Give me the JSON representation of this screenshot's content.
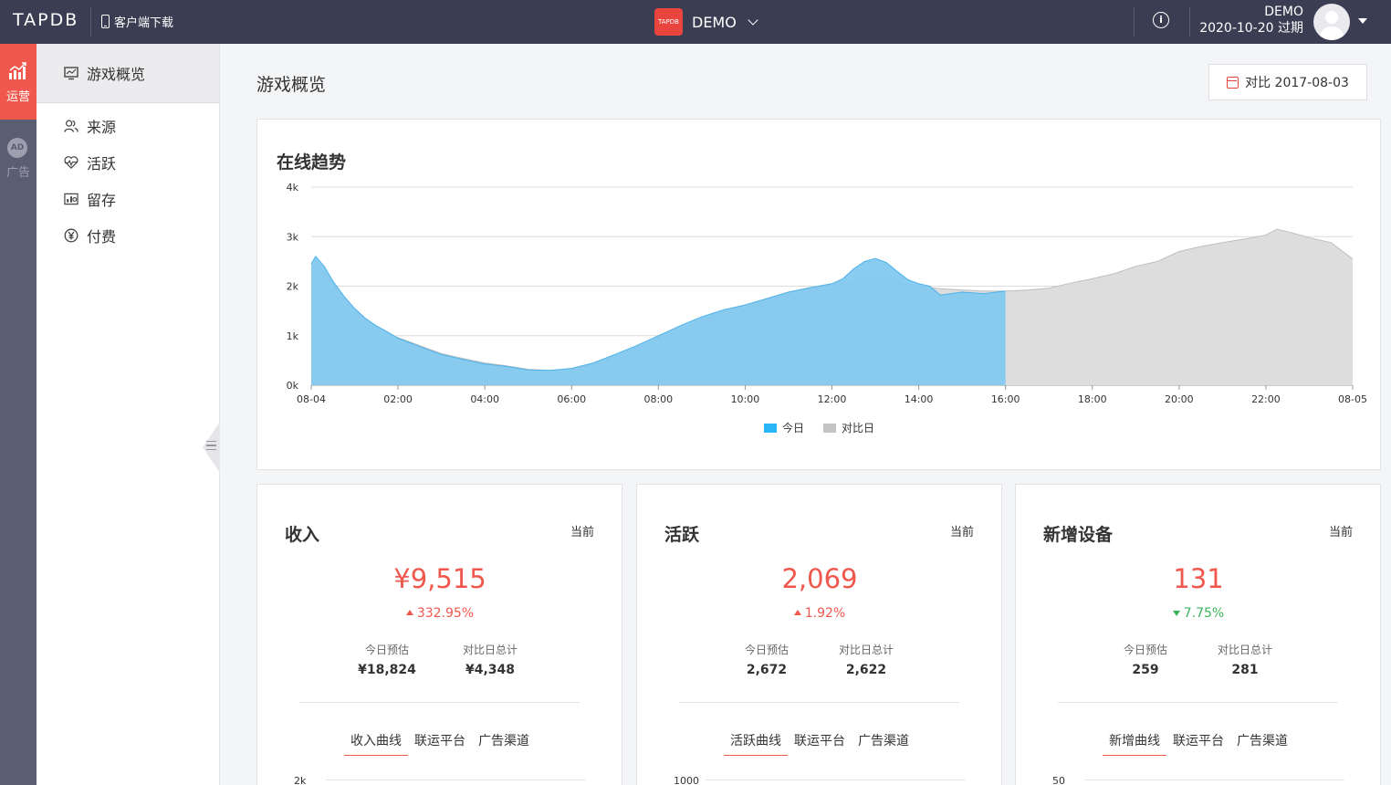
{
  "topbar": {
    "logo": "TAPDB",
    "download": "客户端下载",
    "app_logo_text": "TAPDB",
    "app_name": "DEMO",
    "user_name": "DEMO",
    "user_expiry": "2020-10-20 过期",
    "icons": {
      "download": "phone-icon",
      "info": "info-icon",
      "menu": "chevron-down-icon"
    }
  },
  "rail": {
    "items": [
      {
        "label": "运营",
        "icon": "bar-chart-icon",
        "active": true
      },
      {
        "label": "广告",
        "icon": "ad-icon",
        "icon_text": "AD",
        "active": false
      }
    ]
  },
  "sidebar": {
    "header": {
      "label": "游戏概览",
      "icon": "monitor-icon"
    },
    "items": [
      {
        "label": "来源",
        "icon": "users-icon"
      },
      {
        "label": "活跃",
        "icon": "heartbeat-icon"
      },
      {
        "label": "留存",
        "icon": "image-chart-icon"
      },
      {
        "label": "付费",
        "icon": "yen-icon"
      }
    ]
  },
  "main": {
    "title": "游戏概览",
    "compare_button": "对比 2017-08-03"
  },
  "online_trend": {
    "title": "在线趋势",
    "legend": [
      {
        "name": "今日",
        "color": "#29b6f6"
      },
      {
        "name": "对比日",
        "color": "#c4c4c4"
      }
    ]
  },
  "chart_data": {
    "type": "area",
    "title": "在线趋势",
    "x_ticks": [
      "08-04",
      "02:00",
      "04:00",
      "06:00",
      "08:00",
      "10:00",
      "12:00",
      "14:00",
      "16:00",
      "18:00",
      "20:00",
      "22:00",
      "08-05"
    ],
    "y_ticks": [
      "0k",
      "1k",
      "2k",
      "3k",
      "4k"
    ],
    "ylim": [
      0,
      4000
    ],
    "x_unit": "hours",
    "xlim": [
      0,
      24
    ],
    "legend_position": "bottom-center",
    "grid": true,
    "series": [
      {
        "name": "今日",
        "color": "#29b6f6",
        "x": [
          0,
          0.1,
          0.3,
          0.5,
          0.75,
          1,
          1.25,
          1.5,
          1.75,
          2,
          2.5,
          3,
          3.5,
          4,
          4.5,
          5,
          5.5,
          6,
          6.5,
          7,
          7.5,
          8,
          8.5,
          9,
          9.5,
          10,
          10.5,
          11,
          11.5,
          12,
          12.25,
          12.5,
          12.75,
          13,
          13.25,
          13.5,
          13.75,
          14,
          14.25,
          14.5,
          14.75,
          15,
          15.5,
          16
        ],
        "y": [
          2450,
          2600,
          2400,
          2100,
          1800,
          1550,
          1350,
          1200,
          1080,
          950,
          780,
          620,
          520,
          430,
          380,
          310,
          300,
          340,
          450,
          620,
          800,
          1000,
          1200,
          1380,
          1520,
          1620,
          1750,
          1880,
          1970,
          2050,
          2150,
          2350,
          2500,
          2560,
          2480,
          2300,
          2130,
          2050,
          2000,
          1820,
          1850,
          1880,
          1850,
          1900
        ]
      },
      {
        "name": "对比日",
        "color": "#c4c4c4",
        "x": [
          0,
          0.1,
          0.3,
          0.5,
          0.75,
          1,
          1.25,
          1.5,
          1.75,
          2,
          2.5,
          3,
          3.5,
          4,
          4.5,
          5,
          5.5,
          6,
          6.5,
          7,
          7.5,
          8,
          8.5,
          9,
          9.5,
          10,
          10.5,
          11,
          11.5,
          12,
          12.5,
          13,
          13.5,
          14,
          14.5,
          15,
          15.5,
          16,
          16.5,
          17,
          17.5,
          18,
          18.5,
          19,
          19.5,
          20,
          20.5,
          21,
          21.5,
          22,
          22.25,
          22.5,
          23,
          23.5,
          24
        ],
        "y": [
          2350,
          2500,
          2300,
          2050,
          1750,
          1500,
          1320,
          1180,
          1060,
          960,
          800,
          640,
          540,
          450,
          390,
          320,
          300,
          330,
          430,
          580,
          760,
          940,
          1120,
          1320,
          1480,
          1620,
          1750,
          1880,
          1970,
          2030,
          2080,
          2120,
          2080,
          2000,
          1950,
          1920,
          1900,
          1900,
          1920,
          1960,
          2060,
          2150,
          2250,
          2400,
          2500,
          2700,
          2800,
          2880,
          2950,
          3030,
          3150,
          3100,
          2980,
          2880,
          2550
        ]
      }
    ]
  },
  "kpis": [
    {
      "title": "收入",
      "now_label": "当前",
      "value": "¥9,515",
      "change": "332.95%",
      "direction": "up",
      "sub1_label": "今日预估",
      "sub1_value": "¥18,824",
      "sub2_label": "对比日总计",
      "sub2_value": "¥4,348",
      "tabs": [
        "收入曲线",
        "联运平台",
        "广告渠道"
      ],
      "axis_top": "2k"
    },
    {
      "title": "活跃",
      "now_label": "当前",
      "value": "2,069",
      "change": "1.92%",
      "direction": "up",
      "sub1_label": "今日预估",
      "sub1_value": "2,672",
      "sub2_label": "对比日总计",
      "sub2_value": "2,622",
      "tabs": [
        "活跃曲线",
        "联运平台",
        "广告渠道"
      ],
      "axis_top": "1000"
    },
    {
      "title": "新增设备",
      "now_label": "当前",
      "value": "131",
      "change": "7.75%",
      "direction": "down",
      "sub1_label": "今日预估",
      "sub1_value": "259",
      "sub2_label": "对比日总计",
      "sub2_value": "281",
      "tabs": [
        "新增曲线",
        "联运平台",
        "广告渠道"
      ],
      "axis_top": "50"
    }
  ]
}
